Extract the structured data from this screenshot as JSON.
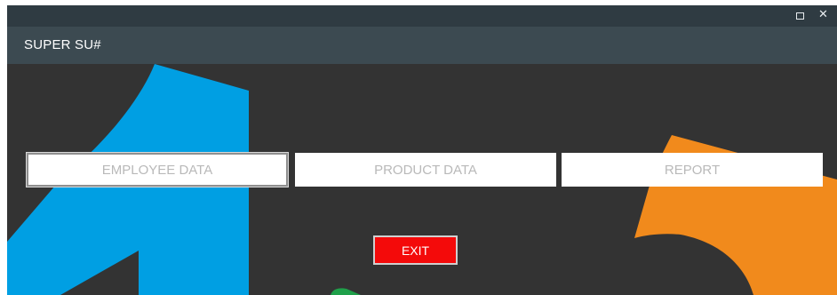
{
  "window": {
    "title": "SUPER SU#",
    "controls": {
      "maximize_icon": "maximize-icon",
      "close_icon": "close-icon",
      "close_glyph": "✕"
    }
  },
  "menu": {
    "employee_label": "EMPLOYEE DATA",
    "product_label": "PRODUCT DATA",
    "report_label": "REPORT",
    "exit_label": "EXIT"
  },
  "colors": {
    "titlebar": "#2f3b42",
    "header": "#3c4a51",
    "body": "#333333",
    "accent_blue": "#009fe3",
    "accent_orange": "#f18a1c",
    "accent_green": "#1fa04a",
    "exit_red": "#f40a0a"
  }
}
